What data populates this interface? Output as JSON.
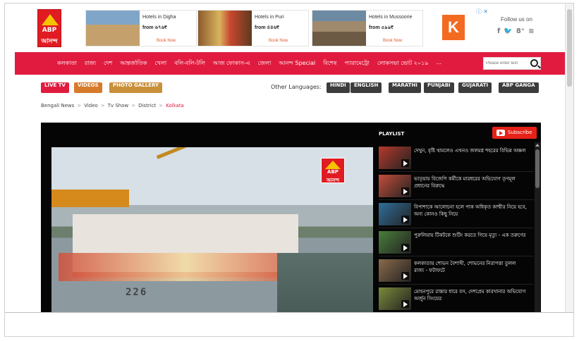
{
  "header": {
    "logo": {
      "text": "ABP",
      "subtext": "আনন্দ"
    },
    "ads": [
      {
        "title": "Hotels in Digha",
        "price": "from ৬৭৬₹",
        "cta": "Book Now"
      },
      {
        "title": "Hotels in Puri",
        "price": "from ৪৪৬₹",
        "cta": "Book Now"
      },
      {
        "title": "Hotels in Mussoorie",
        "price": "from ৫৯৯₹",
        "cta": "Book Now"
      }
    ],
    "k_ad_letter": "K",
    "adchoice": "ⓘ ✕",
    "follow_label": "Follow us on",
    "social_icons": [
      "f",
      "🐦",
      "8⁺",
      "≋"
    ]
  },
  "nav": {
    "items": [
      "কলকাতা",
      "রাজ্য",
      "দেশ",
      "আন্তর্জাতিক",
      "খেলা",
      "বলি-বলি-টলি",
      "আজ ফোকাস-এ",
      "জেলা",
      "আনন্দ Special",
      "বিশেষ",
      "প্যারামেট্রো",
      "লোকসভা ভোট ২০১৯",
      "..."
    ],
    "search_placeholder": "Please enter text"
  },
  "pills": {
    "live": "LIVE TV",
    "videos": "VIDEOS",
    "photo": "PHOTO GALLERY"
  },
  "languages": {
    "label": "Other Languages:",
    "items": [
      "HINDI",
      "ENGLISH",
      "MARATHI",
      "PUNJABI",
      "GUJARATI",
      "ABP GANGA"
    ]
  },
  "breadcrumb": [
    "Bengali News",
    "Video",
    "Tv Show",
    "District",
    "Kolkata"
  ],
  "video": {
    "boat_number": "226",
    "logo_text": "ABP",
    "logo_subtext": "আনন্দ"
  },
  "playlist": {
    "title": "PLAYLIST",
    "subscribe_label": "Subscribe",
    "items": [
      {
        "text": "দেখুন, বৃষ্টি থামলেও এখনও জলমগ্ন শহরের বিভিন্ন অঞ্চল"
      },
      {
        "text": "ভাতৃয়ায় বিজেপি কর্মীকে মারধরের অভিযোগ তৃণমূল প্রধানের বিরুদ্ধে"
      },
      {
        "text": "বিপাশাকে আলোচনা হলে পাক অধিকৃত কাশ্মীর নিয়ে হবে, অন্য কোনও কিছু নিয়ে"
      },
      {
        "text": "পুরুলিয়ায় টিকটকে শুটিং করতে গিয়ে মৃত্যু - এক তরুণের"
      },
      {
        "text": "কলকাতায় শোভন বৈশাখী, শোভনের নিরাপত্তা তুলল রাজ্য - ফটাফটে"
      },
      {
        "text": "মোহনপুরে রাস্তার ধারে বস, দেশপ্রেম কারখানার অভিযোগ অর্জুন সিংয়ের"
      }
    ]
  }
}
